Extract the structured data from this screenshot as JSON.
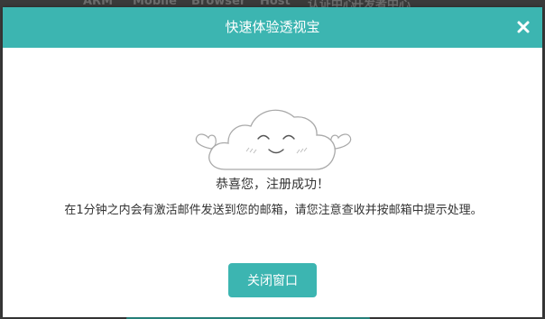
{
  "background_nav": {
    "items": [
      "ARM",
      "Mobile",
      "Browser",
      "Host",
      "认证中心",
      "开发者中心"
    ]
  },
  "dialog": {
    "title": "快速体验透视宝",
    "close_icon": "close-icon",
    "illustration": "smiling-cloud-illustration",
    "success_title": "恭喜您，注册成功！",
    "success_message": "在1分钟之内会有激活邮件发送到您的邮箱，请您注意查收并按邮箱中提示处理。",
    "close_window_label": "关闭窗口"
  },
  "colors": {
    "accent": "#3cb5b1",
    "overlay": "#3a3a3a",
    "text": "#333333",
    "surface": "#ffffff"
  }
}
